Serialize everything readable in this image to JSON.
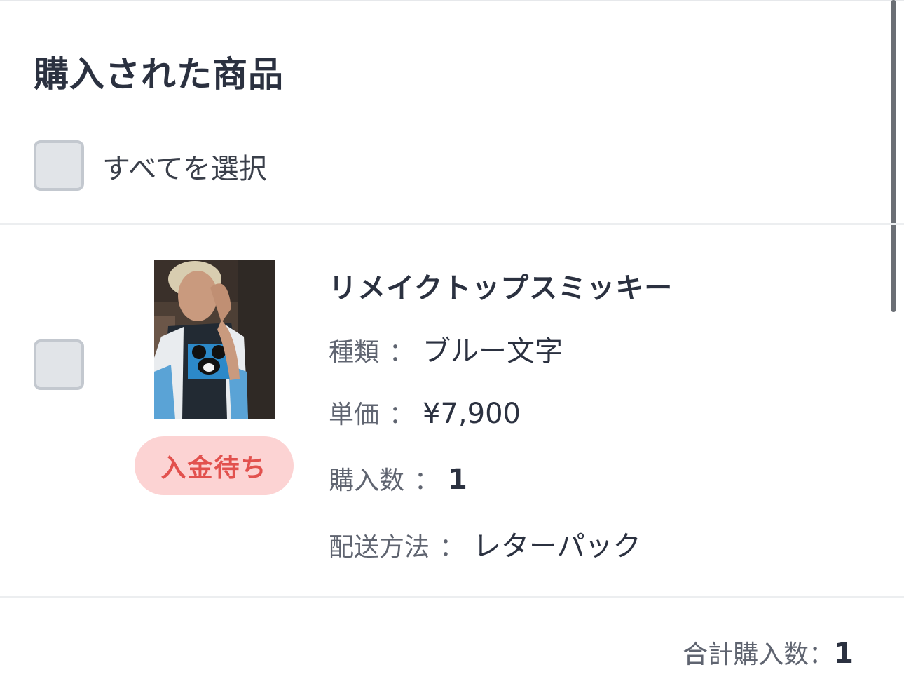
{
  "section": {
    "title": "購入された商品"
  },
  "select_all": {
    "label": "すべてを選択",
    "checked": false
  },
  "item": {
    "checked": false,
    "status": "入金待ち",
    "name": "リメイクトップスミッキー",
    "attributes": [
      {
        "label": "種類",
        "value": "ブルー文字"
      },
      {
        "label": "単価",
        "value": "¥7,900"
      },
      {
        "label": "購入数",
        "value": "1"
      },
      {
        "label": "配送方法",
        "value": "レターパック"
      }
    ],
    "separator": "："
  },
  "summary": {
    "total_label": "合計購入数：",
    "total_value": "1"
  },
  "colors": {
    "text_primary": "#2b3140",
    "text_secondary": "#5f6470",
    "badge_bg": "#fcd3d3",
    "badge_text": "#e2514e",
    "checkbox_fill": "#e1e4e8",
    "checkbox_border": "#c3c8cf"
  }
}
